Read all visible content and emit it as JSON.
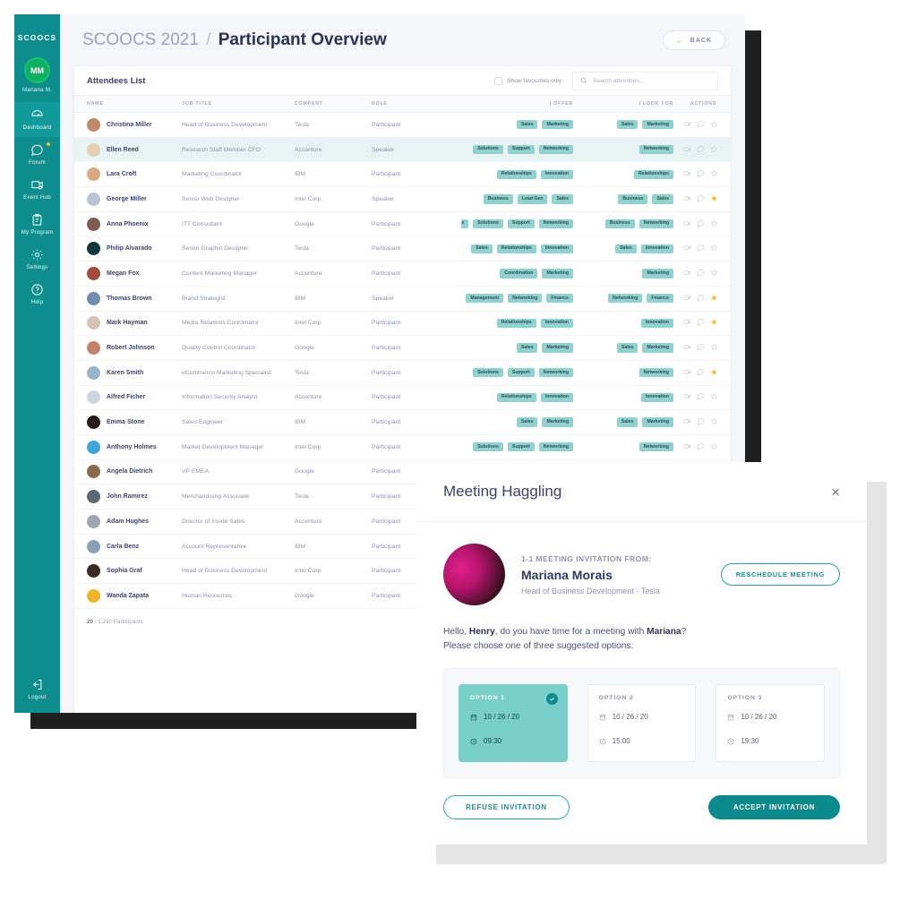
{
  "sidebar": {
    "logo": "SCOOCS",
    "profile": {
      "initials": "MM",
      "name": "Mariana M."
    },
    "items": [
      {
        "label": "Dashboard",
        "icon": "dashboard-icon",
        "active": true,
        "dot": false
      },
      {
        "label": "Forum",
        "icon": "forum-icon",
        "active": false,
        "dot": true
      },
      {
        "label": "Event Hub",
        "icon": "event-hub-icon",
        "active": false,
        "dot": false
      },
      {
        "label": "My Program",
        "icon": "program-icon",
        "active": false,
        "dot": false
      },
      {
        "label": "Settings",
        "icon": "gear-icon",
        "active": false,
        "dot": false
      },
      {
        "label": "Help",
        "icon": "help-icon",
        "active": false,
        "dot": false
      }
    ],
    "logout": {
      "label": "Logout",
      "icon": "logout-icon"
    }
  },
  "header": {
    "title_event": "SCOOCS 2021",
    "title_sep": "/",
    "title_page": "Participant Overview",
    "back_label": "BACK"
  },
  "card": {
    "title": "Attendees List",
    "favourites_label": "Show favourites only",
    "favourites_checked": false,
    "search_placeholder": "Search attendees...",
    "search_value": ""
  },
  "table": {
    "columns": [
      "NAME",
      "JOB TITLE",
      "COMPANY",
      "ROLE",
      "I OFFER",
      "I LOOK FOR",
      "ACTIONS"
    ],
    "footer_count": "20",
    "footer_total": "1.290",
    "footer_label": "Participants",
    "rows": [
      {
        "name": "Christina Miller",
        "job": "Head of Business Development",
        "company": "Tesla",
        "role": "Participant",
        "offer": [
          "Sales",
          "Marketing"
        ],
        "look": [
          "Sales",
          "Marketing"
        ],
        "starred": false,
        "highlight": false,
        "avatar": "#c08a6a"
      },
      {
        "name": "Ellen Reed",
        "job": "Research Staff Member CFO",
        "company": "Accenture",
        "role": "Speaker",
        "offer": [
          "Solutions",
          "Support",
          "Networking"
        ],
        "look": [
          "Networking"
        ],
        "starred": false,
        "highlight": true,
        "avatar": "#e4cfb5"
      },
      {
        "name": "Lara Croft",
        "job": "Marketing Coordinator",
        "company": "IBM",
        "role": "Participant",
        "offer": [
          "Relationships",
          "Innovation"
        ],
        "look": [
          "Relationships"
        ],
        "starred": false,
        "highlight": false,
        "avatar": "#d9a983"
      },
      {
        "name": "George Miller",
        "job": "Senior Web Designer",
        "company": "Intel Corp",
        "role": "Speaker",
        "offer": [
          "Business",
          "Lead Gen",
          "Sales"
        ],
        "look": [
          "Business",
          "Sales"
        ],
        "starred": true,
        "highlight": false,
        "avatar": "#b9c4d2"
      },
      {
        "name": "Anna Phoenix",
        "job": "ITT Consultant",
        "company": "Google",
        "role": "Participant",
        "offer": [
          "Business",
          "Solutions",
          "Support",
          "Networking"
        ],
        "look": [
          "Business",
          "Networking"
        ],
        "starred": false,
        "highlight": false,
        "avatar": "#7d5b52"
      },
      {
        "name": "Philip Alvarado",
        "job": "Senior Graphic Designer",
        "company": "Tesla",
        "role": "Participant",
        "offer": [
          "Sales",
          "Relationships",
          "Innovation"
        ],
        "look": [
          "Sales",
          "Innovation"
        ],
        "starred": false,
        "highlight": false,
        "avatar": "#123a3c"
      },
      {
        "name": "Megan Fox",
        "job": "Content Marketing Manager",
        "company": "Accenture",
        "role": "Participant",
        "offer": [
          "Coordination",
          "Marketing"
        ],
        "look": [
          "Marketing"
        ],
        "starred": false,
        "highlight": false,
        "avatar": "#a34a3a"
      },
      {
        "name": "Thomas Brown",
        "job": "Brand Strategist",
        "company": "IBM",
        "role": "Speaker",
        "offer": [
          "Management",
          "Networking",
          "Finance"
        ],
        "look": [
          "Networking",
          "Finance"
        ],
        "starred": true,
        "highlight": false,
        "avatar": "#6f8fae"
      },
      {
        "name": "Mark Hayman",
        "job": "Media Relations Coordinator",
        "company": "Intel Corp",
        "role": "Participant",
        "offer": [
          "Relationships",
          "Innovation"
        ],
        "look": [
          "Innovation"
        ],
        "starred": true,
        "highlight": false,
        "avatar": "#d5c3b4"
      },
      {
        "name": "Robert Johnson",
        "job": "Quality Control Coordinator",
        "company": "Google",
        "role": "Participant",
        "offer": [
          "Sales",
          "Marketing"
        ],
        "look": [
          "Sales",
          "Marketing"
        ],
        "starred": false,
        "highlight": false,
        "avatar": "#c2836a"
      },
      {
        "name": "Karen Smith",
        "job": "eCommerce Marketing Specialist",
        "company": "Tesla",
        "role": "Participant",
        "offer": [
          "Solutions",
          "Support",
          "Networking"
        ],
        "look": [
          "Networking"
        ],
        "starred": true,
        "highlight": false,
        "avatar": "#9ab3c9"
      },
      {
        "name": "Alfred Ficher",
        "job": "Information Security Analyst",
        "company": "Accenture",
        "role": "Participant",
        "offer": [
          "Relationships",
          "Innovation"
        ],
        "look": [
          "Innovation"
        ],
        "starred": false,
        "highlight": false,
        "avatar": "#cdd6e0"
      },
      {
        "name": "Emma Stone",
        "job": "Sales Engineer",
        "company": "IBM",
        "role": "Participant",
        "offer": [
          "Sales",
          "Marketing"
        ],
        "look": [
          "Sales",
          "Marketing"
        ],
        "starred": false,
        "highlight": false,
        "avatar": "#241a18"
      },
      {
        "name": "Anthony Holmes",
        "job": "Market Development Manager",
        "company": "Intel Corp",
        "role": "Participant",
        "offer": [
          "Solutions",
          "Support",
          "Networking"
        ],
        "look": [
          "Networking"
        ],
        "starred": false,
        "highlight": false,
        "avatar": "#3fa7d6"
      },
      {
        "name": "Angela Dietrich",
        "job": "VP EMEA",
        "company": "Google",
        "role": "Participant",
        "offer": [],
        "look": [],
        "starred": false,
        "highlight": false,
        "avatar": "#8a6a4a"
      },
      {
        "name": "John Ramirez",
        "job": "Merchandising Associate",
        "company": "Tesla",
        "role": "Participant",
        "offer": [],
        "look": [],
        "starred": false,
        "highlight": false,
        "avatar": "#5c6a78"
      },
      {
        "name": "Adam Hughes",
        "job": "Director of Inside Sales",
        "company": "Accenture",
        "role": "Participant",
        "offer": [],
        "look": [],
        "starred": false,
        "highlight": false,
        "avatar": "#9fa6ae"
      },
      {
        "name": "Carla Benz",
        "job": "Account Representative",
        "company": "IBM",
        "role": "Participant",
        "offer": [],
        "look": [],
        "starred": false,
        "highlight": false,
        "avatar": "#87a0b3"
      },
      {
        "name": "Sophia Graf",
        "job": "Head of Business Development",
        "company": "Intel Corp",
        "role": "Participant",
        "offer": [],
        "look": [],
        "starred": false,
        "highlight": false,
        "avatar": "#3a2b22"
      },
      {
        "name": "Wanda Zapata",
        "job": "Human Resources",
        "company": "Google",
        "role": "Participant",
        "offer": [],
        "look": [],
        "starred": false,
        "highlight": false,
        "avatar": "#f0b429"
      }
    ]
  },
  "modal": {
    "title": "Meeting Haggling",
    "close_icon": "×",
    "invitation_label": "1-1 MEETING INVITATION FROM:",
    "sender_name": "Mariana Morais",
    "sender_role": "Head of Business Development - Tesla",
    "reschedule_label": "RESCHEDULE MEETING",
    "greeting_pre": "Hello, ",
    "greeting_recipient": "Henry",
    "greeting_mid": ", do you have time for a meeting with ",
    "greeting_sender": "Mariana",
    "greeting_post": "?",
    "greeting_line2": "Please choose one of three suggested options:",
    "options": [
      {
        "label": "OPTION 1",
        "date": "10 / 26 / 20",
        "time": "09:30",
        "selected": true
      },
      {
        "label": "OPTION 2",
        "date": "10 / 26 / 20",
        "time": "15:00",
        "selected": false
      },
      {
        "label": "OPTION 3",
        "date": "10 / 26 / 20",
        "time": "19:30",
        "selected": false
      }
    ],
    "refuse_label": "REFUSE INVITATION",
    "accept_label": "ACCEPT INVITATION"
  },
  "colors": {
    "brand_teal": "#0d8d8d",
    "tag_teal": "#8fd2cf",
    "option_selected": "#79cfc9",
    "star_gold": "#f5bc1b",
    "avatar_green": "#0db05f",
    "page_bg": "#f4f6fa"
  }
}
